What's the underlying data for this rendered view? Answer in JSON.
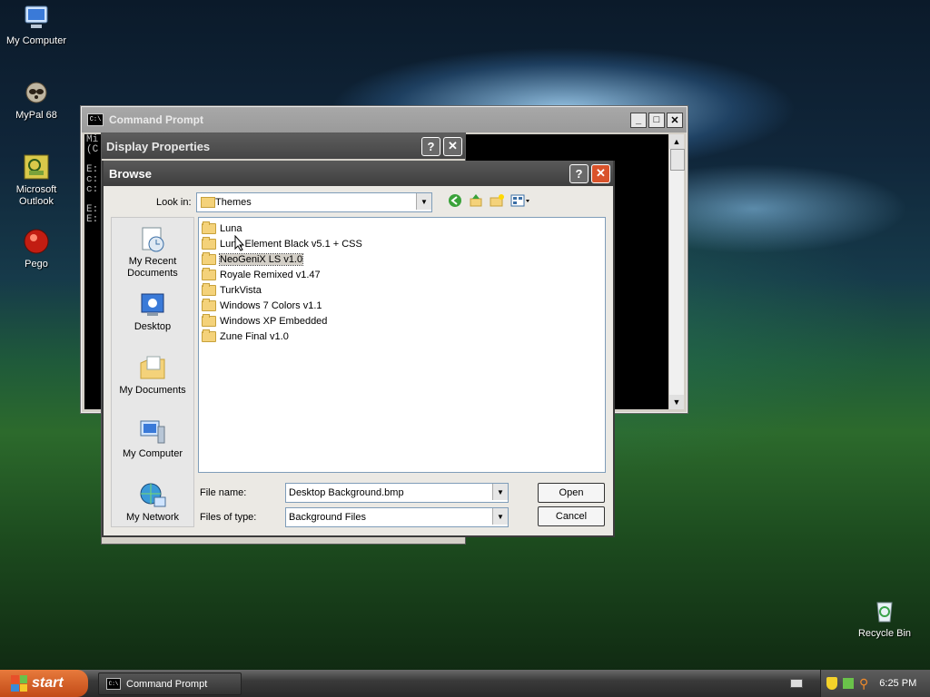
{
  "desktop": {
    "icons": [
      {
        "label": "My Computer"
      },
      {
        "label": "MyPal 68"
      },
      {
        "label": "Microsoft\nOutlook"
      },
      {
        "label": "Pego"
      },
      {
        "label": "Recycle Bin"
      }
    ]
  },
  "cmd_window": {
    "title": "Command Prompt",
    "lines": "Mi\n(C\n\nE:\nc:\nc:\n\nE:\nE:"
  },
  "display_properties": {
    "title": "Display Properties"
  },
  "browse_dialog": {
    "title": "Browse",
    "look_in_label": "Look in:",
    "look_in_value": "Themes",
    "places": [
      {
        "label": "My Recent\nDocuments"
      },
      {
        "label": "Desktop"
      },
      {
        "label": "My Documents"
      },
      {
        "label": "My Computer"
      },
      {
        "label": "My Network"
      }
    ],
    "files": [
      {
        "name": "Luna"
      },
      {
        "name": "Luna Element Black v5.1 + CSS"
      },
      {
        "name": "NeoGeniX LS v1.0"
      },
      {
        "name": "Royale Remixed v1.47"
      },
      {
        "name": "TurkVista"
      },
      {
        "name": "Windows 7 Colors v1.1"
      },
      {
        "name": "Windows XP Embedded"
      },
      {
        "name": "Zune Final v1.0"
      }
    ],
    "file_name_label": "File name:",
    "file_name_value": "Desktop Background.bmp",
    "files_of_type_label": "Files of type:",
    "files_of_type_value": "Background Files",
    "open_label": "Open",
    "cancel_label": "Cancel"
  },
  "taskbar": {
    "start_label": "start",
    "task_label": "Command Prompt",
    "clock": "6:25 PM"
  },
  "colors": {
    "accent_start": "#d9602a",
    "close_red": "#d9532b",
    "folder_yellow": "#f4d27a"
  }
}
